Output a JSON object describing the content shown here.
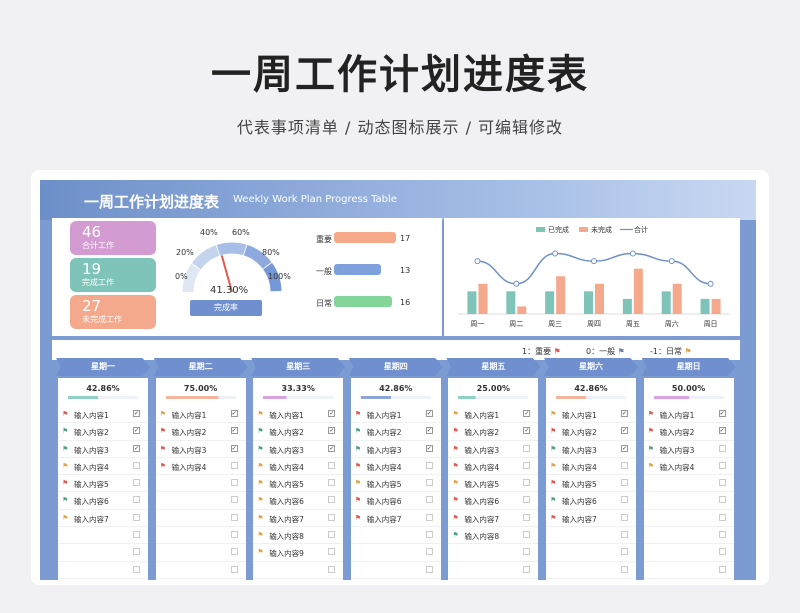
{
  "page": {
    "title": "一周工作计划进度表",
    "subtitle": "代表事项清单 / 动态图标展示 / 可编辑修改"
  },
  "header": {
    "title": "一周工作计划进度表",
    "subtitle_en": "Weekly Work Plan Progress Table"
  },
  "kpis": [
    {
      "value": "46",
      "label": "合计工作",
      "color": "#d39bd2"
    },
    {
      "value": "19",
      "label": "完成工作",
      "color": "#7fc4b8"
    },
    {
      "value": "27",
      "label": "未完成工作",
      "color": "#f4a98c"
    }
  ],
  "gauge": {
    "value": "41.30%",
    "fraction": 0.413,
    "caption": "完成率",
    "ticks": [
      "0%",
      "20%",
      "40%",
      "60%",
      "80%",
      "100%"
    ]
  },
  "priority_bars": [
    {
      "label": "重要",
      "value": 17,
      "color": "#f6a989"
    },
    {
      "label": "一般",
      "value": 13,
      "color": "#7ea1dd"
    },
    {
      "label": "日常",
      "value": 16,
      "color": "#84d59a"
    }
  ],
  "chart_data": {
    "type": "bar",
    "categories": [
      "周一",
      "周二",
      "周三",
      "周四",
      "周五",
      "周六",
      "周日"
    ],
    "series": [
      {
        "name": "已完成",
        "type": "bar",
        "values": [
          3,
          3,
          3,
          3,
          2,
          3,
          2
        ],
        "color": "#7fc4b8"
      },
      {
        "name": "未完成",
        "type": "bar",
        "values": [
          4,
          1,
          5,
          4,
          6,
          4,
          2
        ],
        "color": "#f4a98c"
      },
      {
        "name": "合计",
        "type": "line",
        "values": [
          7,
          4,
          8,
          7,
          8,
          7,
          4
        ],
        "color": "#6f8fc9"
      }
    ],
    "legend": "top"
  },
  "legend_strip": [
    {
      "label": "1：重要",
      "flag": "#e05a4f"
    },
    {
      "label": "0：一般",
      "flag": "#6b7fa8"
    },
    {
      "label": "-1：日常",
      "flag": "#e2a24a"
    }
  ],
  "days": [
    {
      "name": "星期一",
      "pct": "42.86%",
      "fraction": 0.4286,
      "bar": "#8fd1c4",
      "rows": [
        {
          "text": "输入内容1",
          "flag": "r",
          "done": true
        },
        {
          "text": "输入内容2",
          "flag": "g",
          "done": true
        },
        {
          "text": "输入内容3",
          "flag": "g",
          "done": true
        },
        {
          "text": "输入内容4",
          "flag": "o",
          "done": false
        },
        {
          "text": "输入内容5",
          "flag": "r",
          "done": false
        },
        {
          "text": "输入内容6",
          "flag": "g",
          "done": false
        },
        {
          "text": "输入内容7",
          "flag": "o",
          "done": false
        },
        {
          "text": "",
          "flag": "",
          "done": false
        },
        {
          "text": "",
          "flag": "",
          "done": false
        },
        {
          "text": "",
          "flag": "",
          "done": false
        }
      ]
    },
    {
      "name": "星期二",
      "pct": "75.00%",
      "fraction": 0.75,
      "bar": "#f5b49c",
      "rows": [
        {
          "text": "输入内容1",
          "flag": "o",
          "done": true
        },
        {
          "text": "输入内容2",
          "flag": "r",
          "done": true
        },
        {
          "text": "输入内容3",
          "flag": "r",
          "done": true
        },
        {
          "text": "输入内容4",
          "flag": "r",
          "done": false
        },
        {
          "text": "",
          "flag": "",
          "done": false
        },
        {
          "text": "",
          "flag": "",
          "done": false
        },
        {
          "text": "",
          "flag": "",
          "done": false
        },
        {
          "text": "",
          "flag": "",
          "done": false
        },
        {
          "text": "",
          "flag": "",
          "done": false
        },
        {
          "text": "",
          "flag": "",
          "done": false
        }
      ]
    },
    {
      "name": "星期三",
      "pct": "33.33%",
      "fraction": 0.3333,
      "bar": "#d8a3e0",
      "rows": [
        {
          "text": "输入内容1",
          "flag": "o",
          "done": true
        },
        {
          "text": "输入内容2",
          "flag": "g",
          "done": true
        },
        {
          "text": "输入内容3",
          "flag": "g",
          "done": true
        },
        {
          "text": "输入内容4",
          "flag": "o",
          "done": false
        },
        {
          "text": "输入内容5",
          "flag": "o",
          "done": false
        },
        {
          "text": "输入内容6",
          "flag": "o",
          "done": false
        },
        {
          "text": "输入内容7",
          "flag": "o",
          "done": false
        },
        {
          "text": "输入内容8",
          "flag": "o",
          "done": false
        },
        {
          "text": "输入内容9",
          "flag": "o",
          "done": false
        },
        {
          "text": "",
          "flag": "",
          "done": false
        }
      ]
    },
    {
      "name": "星期四",
      "pct": "42.86%",
      "fraction": 0.4286,
      "bar": "#8ea6d8",
      "rows": [
        {
          "text": "输入内容1",
          "flag": "r",
          "done": true
        },
        {
          "text": "输入内容2",
          "flag": "g",
          "done": true
        },
        {
          "text": "输入内容3",
          "flag": "g",
          "done": true
        },
        {
          "text": "输入内容4",
          "flag": "r",
          "done": false
        },
        {
          "text": "输入内容5",
          "flag": "o",
          "done": false
        },
        {
          "text": "输入内容6",
          "flag": "r",
          "done": false
        },
        {
          "text": "输入内容7",
          "flag": "r",
          "done": false
        },
        {
          "text": "",
          "flag": "",
          "done": false
        },
        {
          "text": "",
          "flag": "",
          "done": false
        },
        {
          "text": "",
          "flag": "",
          "done": false
        }
      ]
    },
    {
      "name": "星期五",
      "pct": "25.00%",
      "fraction": 0.25,
      "bar": "#8fd1c4",
      "rows": [
        {
          "text": "输入内容1",
          "flag": "o",
          "done": true
        },
        {
          "text": "输入内容2",
          "flag": "r",
          "done": true
        },
        {
          "text": "输入内容3",
          "flag": "r",
          "done": false
        },
        {
          "text": "输入内容4",
          "flag": "r",
          "done": false
        },
        {
          "text": "输入内容5",
          "flag": "o",
          "done": false
        },
        {
          "text": "输入内容6",
          "flag": "r",
          "done": false
        },
        {
          "text": "输入内容7",
          "flag": "r",
          "done": false
        },
        {
          "text": "输入内容8",
          "flag": "g",
          "done": false
        },
        {
          "text": "",
          "flag": "",
          "done": false
        },
        {
          "text": "",
          "flag": "",
          "done": false
        }
      ]
    },
    {
      "name": "星期六",
      "pct": "42.86%",
      "fraction": 0.4286,
      "bar": "#f5b49c",
      "rows": [
        {
          "text": "输入内容1",
          "flag": "o",
          "done": true
        },
        {
          "text": "输入内容2",
          "flag": "r",
          "done": true
        },
        {
          "text": "输入内容3",
          "flag": "g",
          "done": true
        },
        {
          "text": "输入内容4",
          "flag": "o",
          "done": false
        },
        {
          "text": "输入内容5",
          "flag": "r",
          "done": false
        },
        {
          "text": "输入内容6",
          "flag": "g",
          "done": false
        },
        {
          "text": "输入内容7",
          "flag": "r",
          "done": false
        },
        {
          "text": "",
          "flag": "",
          "done": false
        },
        {
          "text": "",
          "flag": "",
          "done": false
        },
        {
          "text": "",
          "flag": "",
          "done": false
        }
      ]
    },
    {
      "name": "星期日",
      "pct": "50.00%",
      "fraction": 0.5,
      "bar": "#d8a3e0",
      "rows": [
        {
          "text": "输入内容1",
          "flag": "r",
          "done": true
        },
        {
          "text": "输入内容2",
          "flag": "r",
          "done": true
        },
        {
          "text": "输入内容3",
          "flag": "g",
          "done": false
        },
        {
          "text": "输入内容4",
          "flag": "o",
          "done": false
        },
        {
          "text": "",
          "flag": "",
          "done": false
        },
        {
          "text": "",
          "flag": "",
          "done": false
        },
        {
          "text": "",
          "flag": "",
          "done": false
        },
        {
          "text": "",
          "flag": "",
          "done": false
        },
        {
          "text": "",
          "flag": "",
          "done": false
        },
        {
          "text": "",
          "flag": "",
          "done": false
        }
      ]
    }
  ]
}
